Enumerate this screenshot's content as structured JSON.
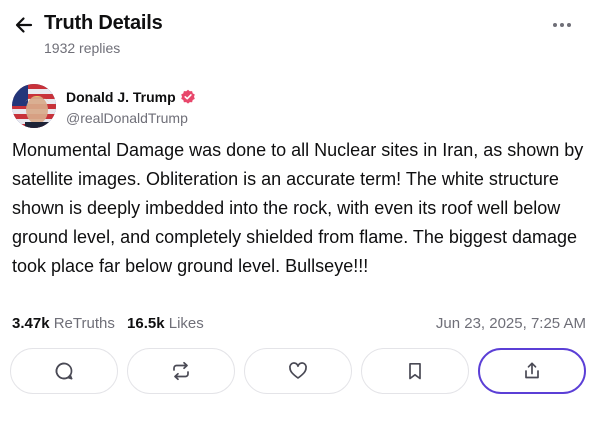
{
  "header": {
    "title": "Truth Details",
    "replies": "1932 replies"
  },
  "post": {
    "author_name": "Donald J. Trump",
    "handle": "@realDonaldTrump",
    "text": "Monumental Damage was done to all Nuclear sites in Iran, as shown by satellite images. Obliteration is an accurate term! The white structure shown is deeply imbedded into the rock, with even its roof well below ground level, and completely shielded from flame. The biggest damage took place far below ground level. Bullseye!!!",
    "retruths_count": "3.47k",
    "retruths_label": "ReTruths",
    "likes_count": "16.5k",
    "likes_label": "Likes",
    "timestamp": "Jun 23, 2025, 7:25 AM"
  },
  "icons": {
    "back": "arrow-left-icon",
    "more": "more-horizontal-icon",
    "verified": "verified-badge-icon",
    "reply": "reply-icon",
    "retruth": "retruth-icon",
    "like": "heart-icon",
    "bookmark": "bookmark-icon",
    "share": "share-icon"
  },
  "colors": {
    "accent": "#5b3fd6",
    "verified": "#e8476b",
    "muted_text": "#6f6f78",
    "border": "#e4e4e8"
  }
}
